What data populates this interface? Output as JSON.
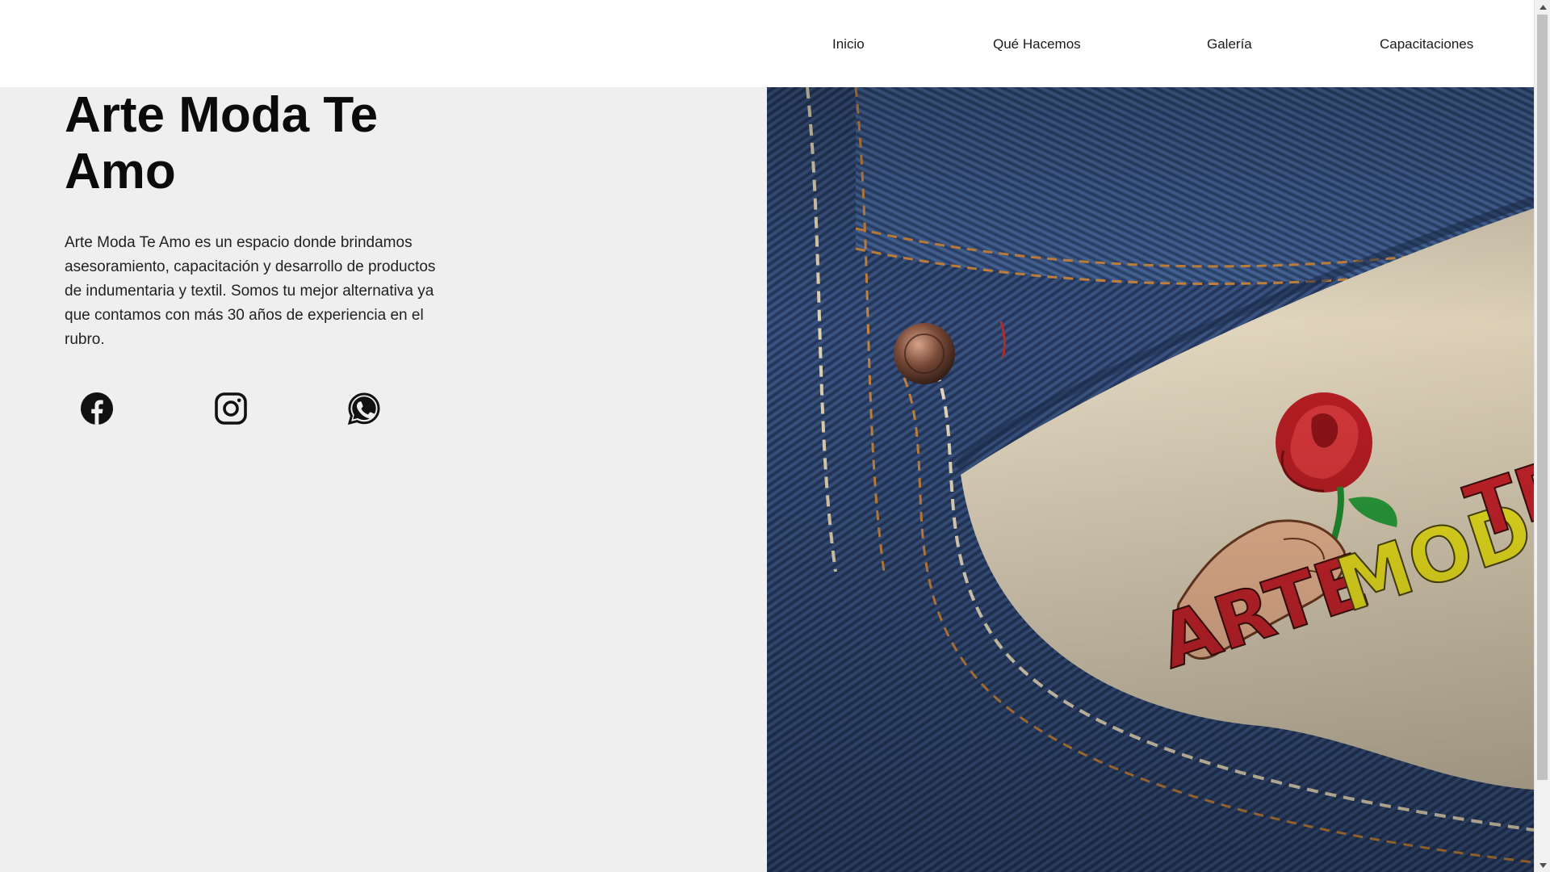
{
  "nav": {
    "items": [
      {
        "label": "Inicio"
      },
      {
        "label": "Qué Hacemos"
      },
      {
        "label": "Galería"
      },
      {
        "label": "Capacitaciones"
      }
    ]
  },
  "hero": {
    "title": "Arte Moda Te Amo",
    "description": "Arte Moda Te Amo es un espacio donde brindamos asesoramiento, capacitación y desarrollo de productos de indumentaria y textil. Somos tu mejor alternativa ya que contamos con más 30 años de experiencia en el rubro."
  },
  "social": {
    "icons": [
      "facebook-icon",
      "instagram-icon",
      "whatsapp-icon"
    ]
  },
  "image": {
    "logo_text": "ARTEMODATE",
    "colors": {
      "denim": "#2a4066",
      "paper": "#ddd2bb",
      "logo_red": "#c4232a",
      "logo_yellow": "#e8df1e",
      "logo_green": "#1f8c2f"
    }
  },
  "colors": {
    "background": "#efefef",
    "header": "#ffffff",
    "text": "#111111"
  }
}
